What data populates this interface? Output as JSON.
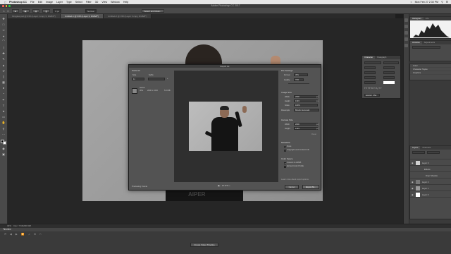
{
  "menubar": {
    "app_name": "Photoshop CC",
    "items": [
      "File",
      "Edit",
      "Image",
      "Layer",
      "Type",
      "Select",
      "Filter",
      "3D",
      "View",
      "Window",
      "Help"
    ],
    "clock": "Mon Feb 27 2:30 PM"
  },
  "window": {
    "title": "Adobe Photoshop CC 2017"
  },
  "options": {
    "feather": "0 px",
    "style": "Normal",
    "select_mask": "Select and Mask..."
  },
  "tabs": [
    {
      "label": "Fireglow.psd @ 33% (Layer 1 copy 3, RGB/8*)",
      "active": false
    },
    {
      "label": "Untitled-1 @ 33% (Layer 3, RGB/8*)",
      "active": true
    },
    {
      "label": "Untitled-2 @ 33% (Layer 3 copy, RGB/8*)",
      "active": false
    }
  ],
  "export_dialog": {
    "title": "Export As",
    "left": {
      "scale_all": "Scale All",
      "size_label": "Size",
      "suffix_label": "Suffix",
      "size_value": "1x",
      "suffix_value": "",
      "asset_name": "hamia",
      "asset_type": "JPG",
      "asset_dims": "2000 x 1333",
      "asset_size": "5.6 MB"
    },
    "zoom": "16.67%",
    "file_settings": {
      "heading": "File Settings",
      "format_label": "Format",
      "format_value": "JPG",
      "quality_label": "Quality",
      "quality_value": "70%"
    },
    "image_size": {
      "heading": "Image Size",
      "width_label": "Width",
      "width_value": "2000",
      "height_label": "Height",
      "height_value": "1333",
      "scale_label": "Scale",
      "scale_value": "100%",
      "resample_label": "Resample",
      "resample_value": "Bicubic Automatic",
      "unit": "px"
    },
    "canvas_size": {
      "heading": "Canvas Size",
      "width_label": "Width",
      "width_value": "2000",
      "height_label": "Height",
      "height_value": "1333",
      "reset": "Reset",
      "unit": "px"
    },
    "metadata": {
      "heading": "Metadata",
      "none": "None",
      "copyright": "Copyright and Contact Info"
    },
    "color_space": {
      "heading": "Color Space",
      "convert": "Convert to sRGB",
      "embed": "Embed Color Profile"
    },
    "learn_more": "Learn more about export options.",
    "cancel": "Cancel",
    "export": "Export All..."
  },
  "right_panels": {
    "histogram_tabs": [
      "Histogram",
      "Info"
    ],
    "libraries_tabs": [
      "Libraries",
      "Adjustments"
    ],
    "properties_rows": [
      "Color",
      "Character Styles",
      "Graphics"
    ],
    "character_tabs": [
      "Character",
      "Paragraph"
    ],
    "character_font": "English: USA",
    "layers_tabs": [
      "Layers",
      "Channels"
    ],
    "layers": [
      {
        "name": "Layer 3",
        "sub": ""
      },
      {
        "name": "Effects",
        "sub": ""
      },
      {
        "name": "Drop Shadow",
        "sub": ""
      },
      {
        "name": "Layer 2",
        "sub": ""
      },
      {
        "name": "Layer 1",
        "sub": ""
      },
      {
        "name": "Layer 0",
        "sub": ""
      }
    ]
  },
  "timeline": {
    "status_zoom": "33%",
    "status_doc": "Doc: 7.63M/38.0M",
    "tab": "Timeline",
    "create_button": "Create Video Timeline"
  },
  "canvas_text": "AIPER"
}
